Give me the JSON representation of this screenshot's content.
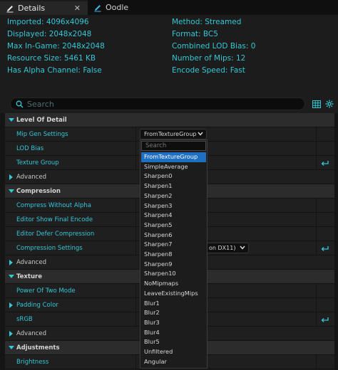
{
  "tabs": [
    {
      "label": "Details",
      "active": true
    },
    {
      "label": "Oodle",
      "active": false
    }
  ],
  "info_left": [
    "Imported: 4096x4096",
    "Displayed: 2048x2048",
    "Max In-Game: 2048x2048",
    "Resource Size: 5461 KB",
    "Has Alpha Channel: False"
  ],
  "info_right": [
    "Method: Streamed",
    "Format: BC5",
    "Combined LOD Bias: 0",
    "Number of Mips: 12",
    "Encode Speed: Fast"
  ],
  "search": {
    "placeholder": "Search"
  },
  "rows": {
    "lod": "Level Of Detail",
    "mip_gen": "Mip Gen Settings",
    "mip_gen_value": "FromTextureGroup",
    "lod_bias": "LOD Bias",
    "texture_group": "Texture Group",
    "advanced1": "Advanced",
    "compression": "Compression",
    "compress_no_alpha": "Compress Without Alpha",
    "editor_show_final": "Editor Show Final Encode",
    "editor_defer": "Editor Defer Compression",
    "compression_settings": "Compression Settings",
    "compression_settings_value": "on DX11)",
    "advanced2": "Advanced",
    "texture": "Texture",
    "power_of_two": "Power Of Two Mode",
    "padding_color": "Padding Color",
    "srgb": "sRGB",
    "advanced3": "Advanced",
    "adjustments": "Adjustments",
    "brightness": "Brightness"
  },
  "dropdown": {
    "search_placeholder": "Search",
    "options": [
      "FromTextureGroup",
      "SimpleAverage",
      "Sharpen0",
      "Sharpen1",
      "Sharpen2",
      "Sharpen3",
      "Sharpen4",
      "Sharpen5",
      "Sharpen6",
      "Sharpen7",
      "Sharpen8",
      "Sharpen9",
      "Sharpen10",
      "NoMipmaps",
      "LeaveExistingMips",
      "Blur1",
      "Blur2",
      "Blur3",
      "Blur4",
      "Blur5",
      "Unfiltered",
      "Angular"
    ],
    "selected": "FromTextureGroup"
  },
  "colors": {
    "accent_cyan": "#35c7d6",
    "selection_blue": "#1e6fc2"
  },
  "icons": [
    "details-pencil-icon",
    "oodle-pencil-icon",
    "close-icon",
    "search-icon",
    "table-view-icon",
    "settings-gear-icon",
    "expand-arrow-icon",
    "collapse-arrow-icon",
    "chevron-down-icon",
    "reset-arrow-icon"
  ]
}
